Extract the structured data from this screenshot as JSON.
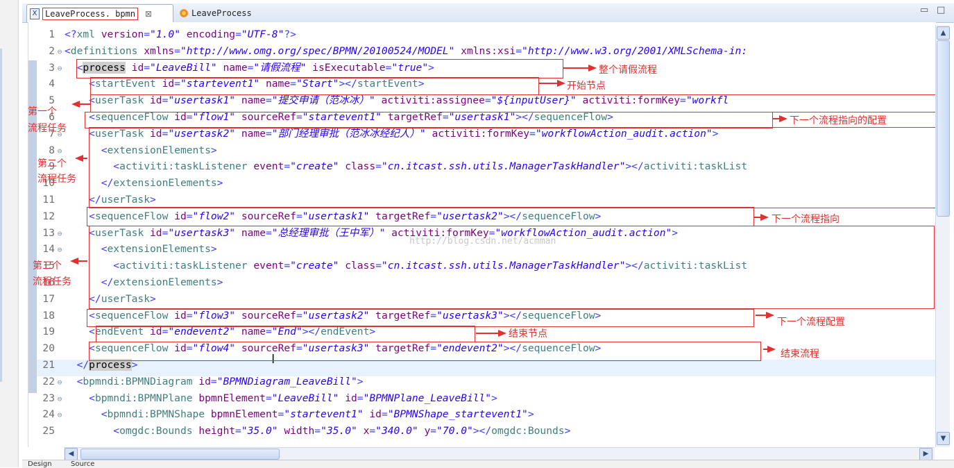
{
  "tabs": [
    {
      "label": "LeaveProcess. bpmn",
      "close": "⊠",
      "icon": "xml-file-icon"
    },
    {
      "label": "LeaveProcess",
      "icon": "bpmn-diagram-icon"
    }
  ],
  "window_controls": {
    "minimize": "▭",
    "maximize": "□"
  },
  "lines": [
    {
      "n": "1",
      "fold": "",
      "tokens": [
        [
          "tg",
          "<?"
        ],
        [
          "tn",
          "xml "
        ],
        [
          "an",
          "version"
        ],
        [
          "tg",
          "="
        ],
        [
          "av",
          "\"1.0\""
        ],
        [
          "an",
          " encoding"
        ],
        [
          "tg",
          "="
        ],
        [
          "av",
          "\"UTF-8\""
        ],
        [
          "tg",
          "?>"
        ]
      ]
    },
    {
      "n": "2",
      "fold": "⊖",
      "tokens": [
        [
          "tg",
          "<"
        ],
        [
          "tn",
          "definitions "
        ],
        [
          "an",
          "xmlns"
        ],
        [
          "tg",
          "="
        ],
        [
          "av",
          "\"http://www.omg.org/spec/BPMN/20100524/MODEL\""
        ],
        [
          "an",
          " xmlns:xsi"
        ],
        [
          "tg",
          "="
        ],
        [
          "av",
          "\"http://www.w3.org/2001/XMLSchema-in:"
        ]
      ]
    },
    {
      "n": "3",
      "fold": "⊖",
      "tokens": [
        [
          "tg",
          "  <"
        ],
        [
          "hl",
          "process"
        ],
        [
          "an",
          " id"
        ],
        [
          "tg",
          "="
        ],
        [
          "av",
          "\"LeaveBill\""
        ],
        [
          "an",
          " name"
        ],
        [
          "tg",
          "="
        ],
        [
          "av",
          "\"请假流程\""
        ],
        [
          "an",
          " isExecutable"
        ],
        [
          "tg",
          "="
        ],
        [
          "av",
          "\"true\""
        ],
        [
          "tg",
          ">"
        ]
      ]
    },
    {
      "n": "4",
      "fold": "",
      "tokens": [
        [
          "tg",
          "    <"
        ],
        [
          "tn",
          "startEvent "
        ],
        [
          "an",
          "id"
        ],
        [
          "tg",
          "="
        ],
        [
          "av",
          "\"startevent1\""
        ],
        [
          "an",
          " name"
        ],
        [
          "tg",
          "="
        ],
        [
          "av",
          "\"Start\""
        ],
        [
          "tg",
          "></"
        ],
        [
          "tn",
          "startEvent"
        ],
        [
          "tg",
          ">"
        ]
      ]
    },
    {
      "n": "5",
      "fold": "",
      "tokens": [
        [
          "tg",
          "    <"
        ],
        [
          "tn",
          "userTask "
        ],
        [
          "an",
          "id"
        ],
        [
          "tg",
          "="
        ],
        [
          "av",
          "\"usertask1\""
        ],
        [
          "an",
          " name"
        ],
        [
          "tg",
          "="
        ],
        [
          "av",
          "\"提交申请（范冰冰）\""
        ],
        [
          "an",
          " activiti:assignee"
        ],
        [
          "tg",
          "="
        ],
        [
          "av",
          "\"${inputUser}\""
        ],
        [
          "an",
          " activiti:formKey"
        ],
        [
          "tg",
          "="
        ],
        [
          "av",
          "\"workfl"
        ]
      ]
    },
    {
      "n": "6",
      "fold": "",
      "tokens": [
        [
          "tg",
          "    <"
        ],
        [
          "tn",
          "sequenceFlow "
        ],
        [
          "an",
          "id"
        ],
        [
          "tg",
          "="
        ],
        [
          "av",
          "\"flow1\""
        ],
        [
          "an",
          " sourceRef"
        ],
        [
          "tg",
          "="
        ],
        [
          "av",
          "\"startevent1\""
        ],
        [
          "an",
          " targetRef"
        ],
        [
          "tg",
          "="
        ],
        [
          "av",
          "\"usertask1\""
        ],
        [
          "tg",
          "></"
        ],
        [
          "tn",
          "sequenceFlow"
        ],
        [
          "tg",
          ">"
        ]
      ]
    },
    {
      "n": "7",
      "fold": "⊖",
      "tokens": [
        [
          "tg",
          "    <"
        ],
        [
          "tn",
          "userTask "
        ],
        [
          "an",
          "id"
        ],
        [
          "tg",
          "="
        ],
        [
          "av",
          "\"usertask2\""
        ],
        [
          "an",
          " name"
        ],
        [
          "tg",
          "="
        ],
        [
          "av",
          "\"部门经理审批（范冰冰经纪人）\""
        ],
        [
          "an",
          " activiti:formKey"
        ],
        [
          "tg",
          "="
        ],
        [
          "av",
          "\"workflowAction_audit.action\""
        ],
        [
          "tg",
          ">"
        ]
      ]
    },
    {
      "n": "8",
      "fold": "⊖",
      "tokens": [
        [
          "tg",
          "      <"
        ],
        [
          "tn",
          "extensionElements"
        ],
        [
          "tg",
          ">"
        ]
      ]
    },
    {
      "n": "9",
      "fold": "",
      "tokens": [
        [
          "tg",
          "        <"
        ],
        [
          "tn",
          "activiti:taskListener "
        ],
        [
          "an",
          "event"
        ],
        [
          "tg",
          "="
        ],
        [
          "av",
          "\"create\""
        ],
        [
          "an",
          " class"
        ],
        [
          "tg",
          "="
        ],
        [
          "av",
          "\"cn.itcast.ssh.utils.ManagerTaskHandler\""
        ],
        [
          "tg",
          "></"
        ],
        [
          "tn",
          "activiti:taskList"
        ]
      ]
    },
    {
      "n": "10",
      "fold": "",
      "tokens": [
        [
          "tg",
          "      </"
        ],
        [
          "tn",
          "extensionElements"
        ],
        [
          "tg",
          ">"
        ]
      ]
    },
    {
      "n": "11",
      "fold": "",
      "tokens": [
        [
          "tg",
          "    </"
        ],
        [
          "tn",
          "userTask"
        ],
        [
          "tg",
          ">"
        ]
      ]
    },
    {
      "n": "12",
      "fold": "",
      "tokens": [
        [
          "tg",
          "    <"
        ],
        [
          "tn",
          "sequenceFlow "
        ],
        [
          "an",
          "id"
        ],
        [
          "tg",
          "="
        ],
        [
          "av",
          "\"flow2\""
        ],
        [
          "an",
          " sourceRef"
        ],
        [
          "tg",
          "="
        ],
        [
          "av",
          "\"usertask1\""
        ],
        [
          "an",
          " targetRef"
        ],
        [
          "tg",
          "="
        ],
        [
          "av",
          "\"usertask2\""
        ],
        [
          "tg",
          "></"
        ],
        [
          "tn",
          "sequenceFlow"
        ],
        [
          "tg",
          ">"
        ]
      ]
    },
    {
      "n": "13",
      "fold": "⊖",
      "tokens": [
        [
          "tg",
          "    <"
        ],
        [
          "tn",
          "userTask "
        ],
        [
          "an",
          "id"
        ],
        [
          "tg",
          "="
        ],
        [
          "av",
          "\"usertask3\""
        ],
        [
          "an",
          " name"
        ],
        [
          "tg",
          "="
        ],
        [
          "av",
          "\"总经理审批（王中军）\""
        ],
        [
          "an",
          " activiti:formKey"
        ],
        [
          "tg",
          "="
        ],
        [
          "av",
          "\"workflowAction_audit.action\""
        ],
        [
          "tg",
          ">"
        ]
      ]
    },
    {
      "n": "14",
      "fold": "⊖",
      "tokens": [
        [
          "tg",
          "      <"
        ],
        [
          "tn",
          "extensionElements"
        ],
        [
          "tg",
          ">"
        ]
      ]
    },
    {
      "n": "15",
      "fold": "",
      "tokens": [
        [
          "tg",
          "        <"
        ],
        [
          "tn",
          "activiti:taskListener "
        ],
        [
          "an",
          "event"
        ],
        [
          "tg",
          "="
        ],
        [
          "av",
          "\"create\""
        ],
        [
          "an",
          " class"
        ],
        [
          "tg",
          "="
        ],
        [
          "av",
          "\"cn.itcast.ssh.utils.ManagerTaskHandler\""
        ],
        [
          "tg",
          "></"
        ],
        [
          "tn",
          "activiti:taskList"
        ]
      ]
    },
    {
      "n": "16",
      "fold": "",
      "tokens": [
        [
          "tg",
          "      </"
        ],
        [
          "tn",
          "extensionElements"
        ],
        [
          "tg",
          ">"
        ]
      ]
    },
    {
      "n": "17",
      "fold": "",
      "tokens": [
        [
          "tg",
          "    </"
        ],
        [
          "tn",
          "userTask"
        ],
        [
          "tg",
          ">"
        ]
      ]
    },
    {
      "n": "18",
      "fold": "",
      "tokens": [
        [
          "tg",
          "    <"
        ],
        [
          "tn",
          "sequenceFlow "
        ],
        [
          "an",
          "id"
        ],
        [
          "tg",
          "="
        ],
        [
          "av",
          "\"flow3\""
        ],
        [
          "an",
          " sourceRef"
        ],
        [
          "tg",
          "="
        ],
        [
          "av",
          "\"usertask2\""
        ],
        [
          "an",
          " targetRef"
        ],
        [
          "tg",
          "="
        ],
        [
          "av",
          "\"usertask3\""
        ],
        [
          "tg",
          "></"
        ],
        [
          "tn",
          "sequenceFlow"
        ],
        [
          "tg",
          ">"
        ]
      ]
    },
    {
      "n": "19",
      "fold": "",
      "tokens": [
        [
          "tg",
          "    <"
        ],
        [
          "tn",
          "endEvent "
        ],
        [
          "an",
          "id"
        ],
        [
          "tg",
          "="
        ],
        [
          "av",
          "\"endevent2\""
        ],
        [
          "an",
          " name"
        ],
        [
          "tg",
          "="
        ],
        [
          "av",
          "\"End\""
        ],
        [
          "tg",
          "></"
        ],
        [
          "tn",
          "endEvent"
        ],
        [
          "tg",
          ">"
        ]
      ]
    },
    {
      "n": "20",
      "fold": "",
      "tokens": [
        [
          "tg",
          "    <"
        ],
        [
          "tn",
          "sequenceFlow "
        ],
        [
          "an",
          "id"
        ],
        [
          "tg",
          "="
        ],
        [
          "av",
          "\"flow4\""
        ],
        [
          "an",
          " sourceRef"
        ],
        [
          "tg",
          "="
        ],
        [
          "av",
          "\"usertask3\""
        ],
        [
          "an",
          " targetRef"
        ],
        [
          "tg",
          "="
        ],
        [
          "av",
          "\"endevent2\""
        ],
        [
          "tg",
          "></"
        ],
        [
          "tn",
          "sequenceFlow"
        ],
        [
          "tg",
          ">"
        ]
      ]
    },
    {
      "n": "21",
      "fold": "",
      "tokens": [
        [
          "tg",
          "  </"
        ],
        [
          "hl",
          "process"
        ],
        [
          "tg",
          ">"
        ]
      ]
    },
    {
      "n": "22",
      "fold": "⊖",
      "tokens": [
        [
          "tg",
          "  <"
        ],
        [
          "tn",
          "bpmndi:BPMNDiagram "
        ],
        [
          "an",
          "id"
        ],
        [
          "tg",
          "="
        ],
        [
          "av",
          "\"BPMNDiagram_LeaveBill\""
        ],
        [
          "tg",
          ">"
        ]
      ]
    },
    {
      "n": "23",
      "fold": "⊖",
      "tokens": [
        [
          "tg",
          "    <"
        ],
        [
          "tn",
          "bpmndi:BPMNPlane "
        ],
        [
          "an",
          "bpmnElement"
        ],
        [
          "tg",
          "="
        ],
        [
          "av",
          "\"LeaveBill\""
        ],
        [
          "an",
          " id"
        ],
        [
          "tg",
          "="
        ],
        [
          "av",
          "\"BPMNPlane_LeaveBill\""
        ],
        [
          "tg",
          ">"
        ]
      ]
    },
    {
      "n": "24",
      "fold": "⊖",
      "tokens": [
        [
          "tg",
          "      <"
        ],
        [
          "tn",
          "bpmndi:BPMNShape "
        ],
        [
          "an",
          "bpmnElement"
        ],
        [
          "tg",
          "="
        ],
        [
          "av",
          "\"startevent1\""
        ],
        [
          "an",
          " id"
        ],
        [
          "tg",
          "="
        ],
        [
          "av",
          "\"BPMNShape_startevent1\""
        ],
        [
          "tg",
          ">"
        ]
      ]
    },
    {
      "n": "25",
      "fold": "",
      "tokens": [
        [
          "tg",
          "        <"
        ],
        [
          "tn",
          "omgdc:Bounds "
        ],
        [
          "an",
          "height"
        ],
        [
          "tg",
          "="
        ],
        [
          "av",
          "\"35.0\""
        ],
        [
          "an",
          " width"
        ],
        [
          "tg",
          "="
        ],
        [
          "av",
          "\"35.0\""
        ],
        [
          "an",
          " x"
        ],
        [
          "tg",
          "="
        ],
        [
          "av",
          "\"340.0\""
        ],
        [
          "an",
          " y"
        ],
        [
          "tg",
          "="
        ],
        [
          "av",
          "\"70.0\""
        ],
        [
          "tg",
          "></"
        ],
        [
          "tn",
          "omgdc:Bounds"
        ],
        [
          "tg",
          ">"
        ]
      ]
    }
  ],
  "annotations": {
    "a1": "整个请假流程",
    "a2": "开始节点",
    "a3": "下一个流程指向的配置",
    "a4": "下一个流程指向",
    "a5": "下一个流程配置",
    "a6": "结束节点",
    "a7": "结束流程",
    "l1a": "第一个",
    "l1b": "流程任务",
    "l2a": "第二个",
    "l2b": "流程任务",
    "l3a": "第三个",
    "l3b": "流程任务"
  },
  "watermark": "http://blog.csdn.net/acmman",
  "scroll": {
    "up": "▲",
    "down": "▼",
    "left": "◀",
    "right": "▶"
  },
  "bottom_tabs": [
    "Design",
    "Source"
  ],
  "colors": {
    "annotation": "#e03030",
    "tag": "#3b3bff",
    "attr_name": "#7f007f",
    "attr_value": "#2a00ff"
  }
}
